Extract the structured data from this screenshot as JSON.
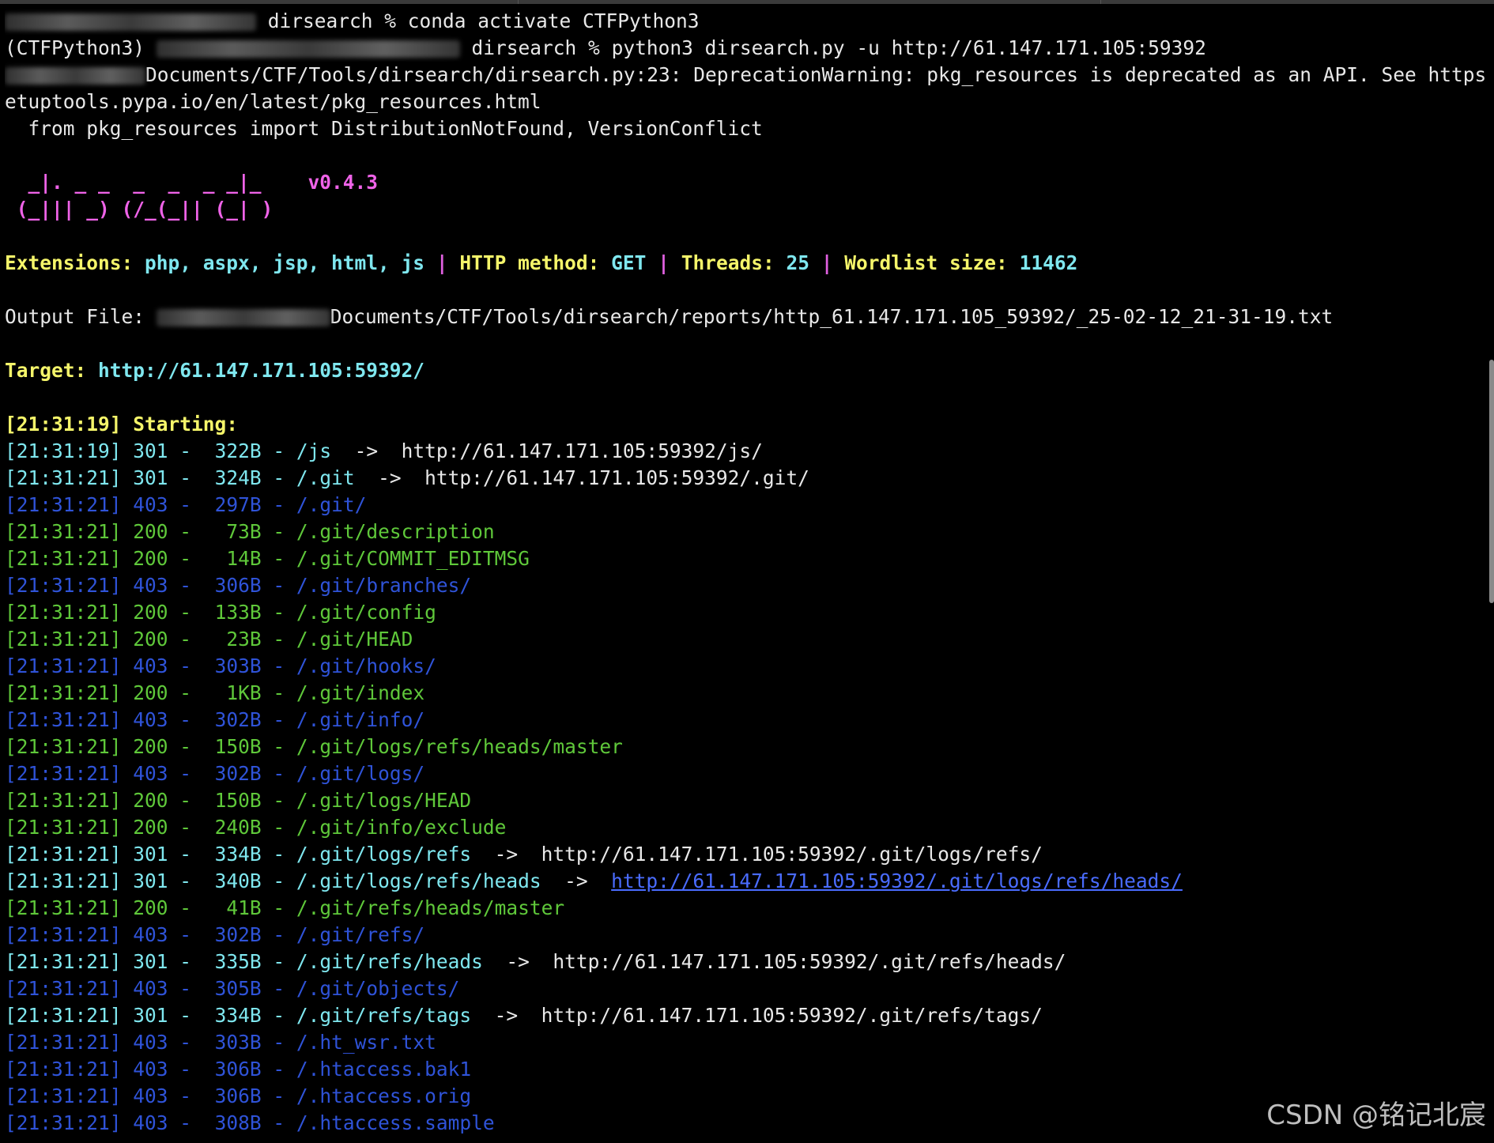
{
  "terminal": {
    "prompt1": {
      "dir": "dirsearch %",
      "command": "conda activate CTFPython3"
    },
    "prompt2": {
      "env": "(CTFPython3)",
      "dir": "dirsearch %",
      "command": "python3 dirsearch.py -u http://61.147.171.105:59392"
    },
    "warning_line1": "Documents/CTF/Tools/dirsearch/dirsearch.py:23: DeprecationWarning: pkg_resources is deprecated as an API. See https://s",
    "warning_line2": "etuptools.pypa.io/en/latest/pkg_resources.html",
    "warning_line3": "  from pkg_resources import DistributionNotFound, VersionConflict",
    "banner_line1": "  _|. _ _  _  _  _ _|_",
    "banner_version": "v0.4.3",
    "banner_line2": " (_||| _) (/_(_|| (_| )",
    "config": {
      "ext_label": "Extensions:",
      "ext_value": "php, aspx, jsp, html, js",
      "sep": "|",
      "method_label": "HTTP method:",
      "method_value": "GET",
      "threads_label": "Threads:",
      "threads_value": "25",
      "wordlist_label": "Wordlist size:",
      "wordlist_value": "11462"
    },
    "output": {
      "label": "Output File:",
      "path": "Documents/CTF/Tools/dirsearch/reports/http_61.147.171.105_59392/_25-02-12_21-31-19.txt"
    },
    "target": {
      "label": "Target:",
      "url": "http://61.147.171.105:59392/"
    },
    "starting": "[21:31:19] Starting:",
    "results": [
      {
        "ts": "[21:31:19]",
        "status": "301",
        "size": "322B",
        "path": "/js",
        "redirect": "http://61.147.171.105:59392/js/",
        "kind": "redirect"
      },
      {
        "ts": "[21:31:21]",
        "status": "301",
        "size": "324B",
        "path": "/.git",
        "redirect": "http://61.147.171.105:59392/.git/",
        "kind": "redirect"
      },
      {
        "ts": "[21:31:21]",
        "status": "403",
        "size": "297B",
        "path": "/.git/",
        "redirect": "",
        "kind": "forbidden"
      },
      {
        "ts": "[21:31:21]",
        "status": "200",
        "size": "73B",
        "path": "/.git/description",
        "redirect": "",
        "kind": "ok"
      },
      {
        "ts": "[21:31:21]",
        "status": "200",
        "size": "14B",
        "path": "/.git/COMMIT_EDITMSG",
        "redirect": "",
        "kind": "ok"
      },
      {
        "ts": "[21:31:21]",
        "status": "403",
        "size": "306B",
        "path": "/.git/branches/",
        "redirect": "",
        "kind": "forbidden"
      },
      {
        "ts": "[21:31:21]",
        "status": "200",
        "size": "133B",
        "path": "/.git/config",
        "redirect": "",
        "kind": "ok"
      },
      {
        "ts": "[21:31:21]",
        "status": "200",
        "size": "23B",
        "path": "/.git/HEAD",
        "redirect": "",
        "kind": "ok"
      },
      {
        "ts": "[21:31:21]",
        "status": "403",
        "size": "303B",
        "path": "/.git/hooks/",
        "redirect": "",
        "kind": "forbidden"
      },
      {
        "ts": "[21:31:21]",
        "status": "200",
        "size": "1KB",
        "path": "/.git/index",
        "redirect": "",
        "kind": "ok"
      },
      {
        "ts": "[21:31:21]",
        "status": "403",
        "size": "302B",
        "path": "/.git/info/",
        "redirect": "",
        "kind": "forbidden"
      },
      {
        "ts": "[21:31:21]",
        "status": "200",
        "size": "150B",
        "path": "/.git/logs/refs/heads/master",
        "redirect": "",
        "kind": "ok"
      },
      {
        "ts": "[21:31:21]",
        "status": "403",
        "size": "302B",
        "path": "/.git/logs/",
        "redirect": "",
        "kind": "forbidden"
      },
      {
        "ts": "[21:31:21]",
        "status": "200",
        "size": "150B",
        "path": "/.git/logs/HEAD",
        "redirect": "",
        "kind": "ok"
      },
      {
        "ts": "[21:31:21]",
        "status": "200",
        "size": "240B",
        "path": "/.git/info/exclude",
        "redirect": "",
        "kind": "ok"
      },
      {
        "ts": "[21:31:21]",
        "status": "301",
        "size": "334B",
        "path": "/.git/logs/refs",
        "redirect": "http://61.147.171.105:59392/.git/logs/refs/",
        "kind": "redirect"
      },
      {
        "ts": "[21:31:21]",
        "status": "301",
        "size": "340B",
        "path": "/.git/logs/refs/heads",
        "redirect": "http://61.147.171.105:59392/.git/logs/refs/heads/",
        "kind": "redirect-link"
      },
      {
        "ts": "[21:31:21]",
        "status": "200",
        "size": "41B",
        "path": "/.git/refs/heads/master",
        "redirect": "",
        "kind": "ok"
      },
      {
        "ts": "[21:31:21]",
        "status": "403",
        "size": "302B",
        "path": "/.git/refs/",
        "redirect": "",
        "kind": "forbidden"
      },
      {
        "ts": "[21:31:21]",
        "status": "301",
        "size": "335B",
        "path": "/.git/refs/heads",
        "redirect": "http://61.147.171.105:59392/.git/refs/heads/",
        "kind": "redirect"
      },
      {
        "ts": "[21:31:21]",
        "status": "403",
        "size": "305B",
        "path": "/.git/objects/",
        "redirect": "",
        "kind": "forbidden"
      },
      {
        "ts": "[21:31:21]",
        "status": "301",
        "size": "334B",
        "path": "/.git/refs/tags",
        "redirect": "http://61.147.171.105:59392/.git/refs/tags/",
        "kind": "redirect"
      },
      {
        "ts": "[21:31:21]",
        "status": "403",
        "size": "303B",
        "path": "/.ht_wsr.txt",
        "redirect": "",
        "kind": "forbidden"
      },
      {
        "ts": "[21:31:21]",
        "status": "403",
        "size": "306B",
        "path": "/.htaccess.bak1",
        "redirect": "",
        "kind": "forbidden"
      },
      {
        "ts": "[21:31:21]",
        "status": "403",
        "size": "306B",
        "path": "/.htaccess.orig",
        "redirect": "",
        "kind": "forbidden"
      },
      {
        "ts": "[21:31:21]",
        "status": "403",
        "size": "308B",
        "path": "/.htaccess.sample",
        "redirect": "",
        "kind": "forbidden"
      }
    ]
  },
  "watermark": "CSDN @铭记北宸",
  "colors": {
    "background": "#000000",
    "text": "#e8e8e8",
    "yellow": "#f5f56a",
    "cyan": "#7fe7ef",
    "magenta": "#ef63e8",
    "green": "#5fc83a",
    "blue": "#2f53d8",
    "link": "#4a6cff"
  }
}
